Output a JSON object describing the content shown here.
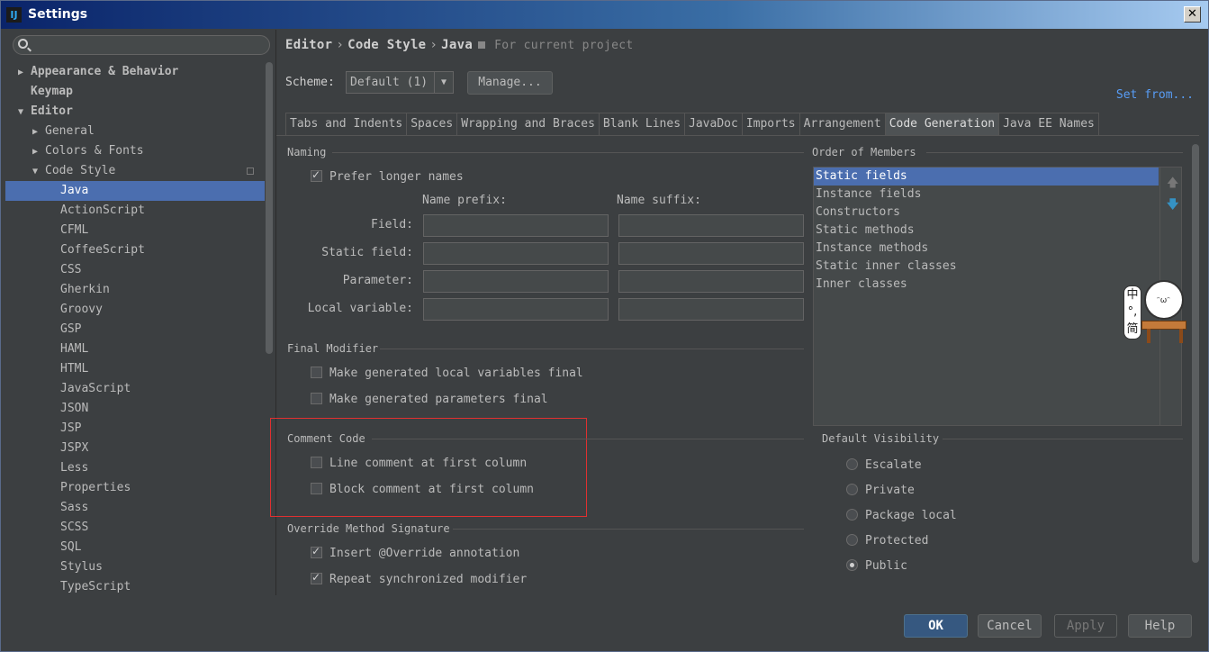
{
  "window": {
    "title": "Settings",
    "app_icon": "IJ"
  },
  "sidebar": {
    "search_placeholder": "",
    "items": [
      {
        "label": "Appearance & Behavior",
        "arrow": "▶"
      },
      {
        "label": "Keymap",
        "arrow": ""
      },
      {
        "label": "Editor",
        "arrow": "▼"
      },
      {
        "label": "General",
        "arrow": "▶"
      },
      {
        "label": "Colors & Fonts",
        "arrow": "▶"
      },
      {
        "label": "Code Style",
        "arrow": "▼"
      },
      {
        "label": "Java"
      },
      {
        "label": "ActionScript"
      },
      {
        "label": "CFML"
      },
      {
        "label": "CoffeeScript"
      },
      {
        "label": "CSS"
      },
      {
        "label": "Gherkin"
      },
      {
        "label": "Groovy"
      },
      {
        "label": "GSP"
      },
      {
        "label": "HAML"
      },
      {
        "label": "HTML"
      },
      {
        "label": "JavaScript"
      },
      {
        "label": "JSON"
      },
      {
        "label": "JSP"
      },
      {
        "label": "JSPX"
      },
      {
        "label": "Less"
      },
      {
        "label": "Properties"
      },
      {
        "label": "Sass"
      },
      {
        "label": "SCSS"
      },
      {
        "label": "SQL"
      },
      {
        "label": "Stylus"
      },
      {
        "label": "TypeScript"
      }
    ]
  },
  "breadcrumb": {
    "part1": "Editor",
    "part2": "Code Style",
    "part3": "Java",
    "sep": "›",
    "note": "For current project"
  },
  "scheme": {
    "label": "Scheme:",
    "value": "Default (1)",
    "arrow": "▼",
    "manage": "Manage...",
    "set_from": "Set from..."
  },
  "tabs": [
    "Tabs and Indents",
    "Spaces",
    "Wrapping and Braces",
    "Blank Lines",
    "JavaDoc",
    "Imports",
    "Arrangement",
    "Code Generation",
    "Java EE Names"
  ],
  "naming": {
    "title": "Naming",
    "prefer_longer": "Prefer longer names",
    "prefix_head": "Name prefix:",
    "suffix_head": "Name suffix:",
    "rows": [
      "Field:",
      "Static field:",
      "Parameter:",
      "Local variable:"
    ]
  },
  "final_modifier": {
    "title": "Final Modifier",
    "local_vars": "Make generated local variables final",
    "params": "Make generated parameters final"
  },
  "comment_code": {
    "title": "Comment Code",
    "line": "Line comment at first column",
    "block": "Block comment at first column"
  },
  "override": {
    "title": "Override Method Signature",
    "insert": "Insert @Override annotation",
    "repeat": "Repeat synchronized modifier"
  },
  "order_of_members": {
    "title": "Order of Members",
    "items": [
      "Static fields",
      "Instance fields",
      "Constructors",
      "Static methods",
      "Instance methods",
      "Static inner classes",
      "Inner classes"
    ],
    "up_icon": "🡅",
    "down_icon": "🡇"
  },
  "visibility": {
    "title": "Default Visibility",
    "options": [
      "Escalate",
      "Private",
      "Package local",
      "Protected",
      "Public"
    ],
    "selected": "Public"
  },
  "sticker": {
    "line1": "中",
    "line2": "°,",
    "line3": "简",
    "face": "ᵔωᵔ"
  },
  "footer": {
    "ok": "OK",
    "cancel": "Cancel",
    "apply": "Apply",
    "help": "Help"
  },
  "colors": {
    "selection": "#4b6eaf",
    "link": "#589df6",
    "highlight_box": "#e03030"
  }
}
